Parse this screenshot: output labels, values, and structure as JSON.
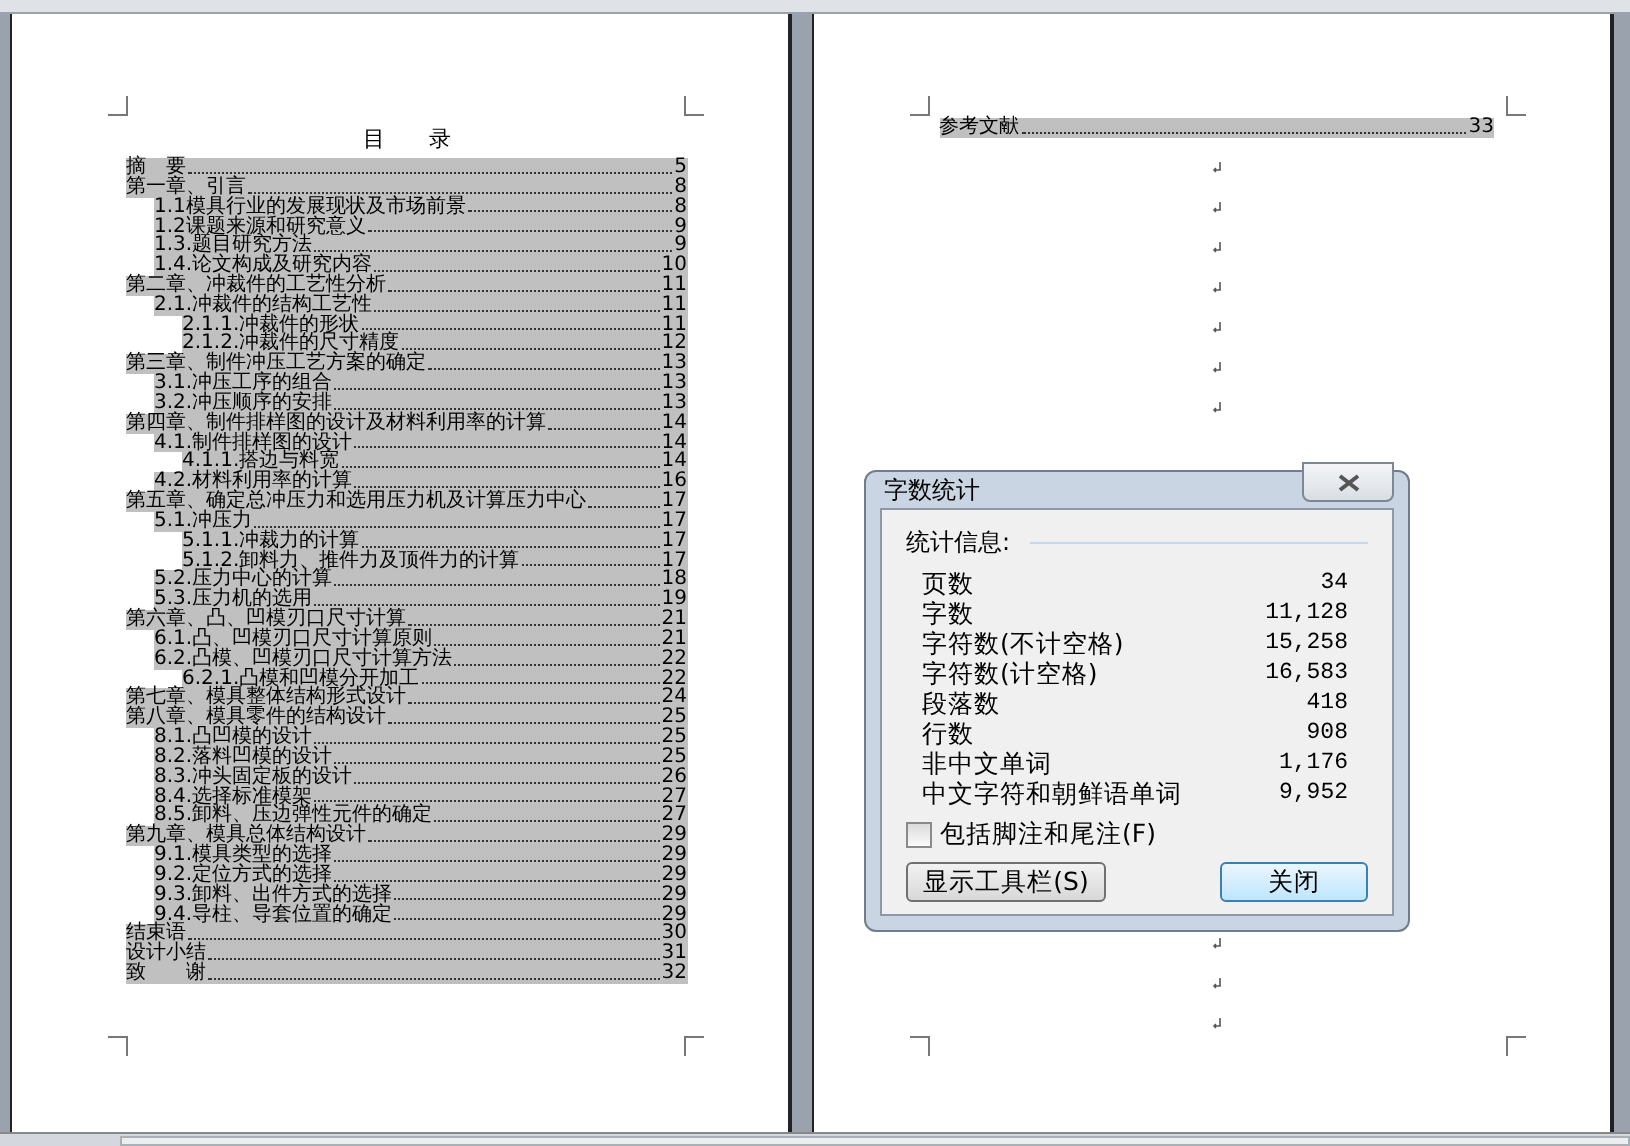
{
  "left_page": {
    "heading": "目　　录",
    "toc": [
      {
        "title": "摘　要",
        "page": "5"
      },
      {
        "title": "第一章、引言",
        "page": "8",
        "children": [
          {
            "title": "1.1模具行业的发展现状及市场前景",
            "page": "8"
          },
          {
            "title": "1.2课题来源和研究意义",
            "page": "9"
          },
          {
            "title": "1.3.题目研究方法",
            "page": "9"
          },
          {
            "title": "1.4.论文构成及研究内容",
            "page": "10"
          }
        ]
      },
      {
        "title": "第二章、冲裁件的工艺性分析",
        "page": "11",
        "children": [
          {
            "title": "2.1.冲裁件的结构工艺性",
            "page": "11",
            "children": [
              {
                "title": "2.1.1.冲裁件的形状",
                "page": "11"
              },
              {
                "title": "2.1.2.冲裁件的尺寸精度",
                "page": "12"
              }
            ]
          }
        ]
      },
      {
        "title": "第三章、制件冲压工艺方案的确定",
        "page": "13",
        "children": [
          {
            "title": "3.1.冲压工序的组合",
            "page": "13"
          },
          {
            "title": "3.2.冲压顺序的安排",
            "page": "13"
          }
        ]
      },
      {
        "title": "第四章、制件排样图的设计及材料利用率的计算",
        "page": "14",
        "children": [
          {
            "title": "4.1.制件排样图的设计",
            "page": "14",
            "children": [
              {
                "title": "4.1.1.搭边与料宽",
                "page": "14"
              }
            ]
          },
          {
            "title": "4.2.材料利用率的计算",
            "page": "16"
          }
        ]
      },
      {
        "title": "第五章、确定总冲压力和选用压力机及计算压力中心",
        "page": "17",
        "children": [
          {
            "title": "5.1.冲压力",
            "page": "17",
            "children": [
              {
                "title": "5.1.1.冲裁力的计算",
                "page": "17"
              },
              {
                "title": "5.1.2.卸料力、推件力及顶件力的计算",
                "page": "17"
              }
            ]
          },
          {
            "title": "5.2.压力中心的计算",
            "page": "18"
          },
          {
            "title": "5.3.压力机的选用",
            "page": "19"
          }
        ]
      },
      {
        "title": "第六章、凸、凹模刃口尺寸计算",
        "page": "21",
        "children": [
          {
            "title": "6.1.凸、凹模刃口尺寸计算原则",
            "page": "21"
          },
          {
            "title": "6.2.凸模、凹模刃口尺寸计算方法",
            "page": "22",
            "children": [
              {
                "title": "6.2.1.凸模和凹模分开加工",
                "page": "22"
              }
            ]
          }
        ]
      },
      {
        "title": "第七章、模具整体结构形式设计",
        "page": "24"
      },
      {
        "title": "第八章、模具零件的结构设计",
        "page": "25",
        "children": [
          {
            "title": "8.1.凸凹模的设计",
            "page": "25"
          },
          {
            "title": "8.2.落料凹模的设计",
            "page": "25"
          },
          {
            "title": "8.3.冲头固定板的设计",
            "page": "26"
          },
          {
            "title": "8.4.选择标准模架",
            "page": "27"
          },
          {
            "title": "8.5.卸料、压边弹性元件的确定",
            "page": "27"
          }
        ]
      },
      {
        "title": "第九章、模具总体结构设计",
        "page": "29",
        "children": [
          {
            "title": "9.1.模具类型的选择",
            "page": "29"
          },
          {
            "title": "9.2.定位方式的选择",
            "page": "29"
          },
          {
            "title": "9.3.卸料、出件方式的选择",
            "page": "29"
          },
          {
            "title": "9.4.导柱、导套位置的确定",
            "page": "29"
          }
        ]
      },
      {
        "title": "结束语",
        "page": "30"
      },
      {
        "title": "设计小结",
        "page": "31"
      },
      {
        "title": "致　　谢",
        "page": "32"
      }
    ]
  },
  "right_page": {
    "toc": [
      {
        "title": "参考文献",
        "page": "33"
      }
    ]
  },
  "dialog": {
    "title": "字数统计",
    "group_label": "统计信息:",
    "stats": [
      {
        "label": "页数",
        "value": "34"
      },
      {
        "label": "字数",
        "value": "11,128"
      },
      {
        "label": "字符数(不计空格)",
        "value": "15,258"
      },
      {
        "label": "字符数(计空格)",
        "value": "16,583"
      },
      {
        "label": "段落数",
        "value": "418"
      },
      {
        "label": "行数",
        "value": "908"
      },
      {
        "label": "非中文单词",
        "value": "1,176"
      },
      {
        "label": "中文字符和朝鲜语单词",
        "value": "9,952"
      }
    ],
    "checkbox": {
      "label": "包括脚注和尾注(F)",
      "checked": false
    },
    "buttons": [
      {
        "label": "显示工具栏(S)",
        "default": false
      },
      {
        "label": "关闭",
        "default": true
      }
    ]
  }
}
